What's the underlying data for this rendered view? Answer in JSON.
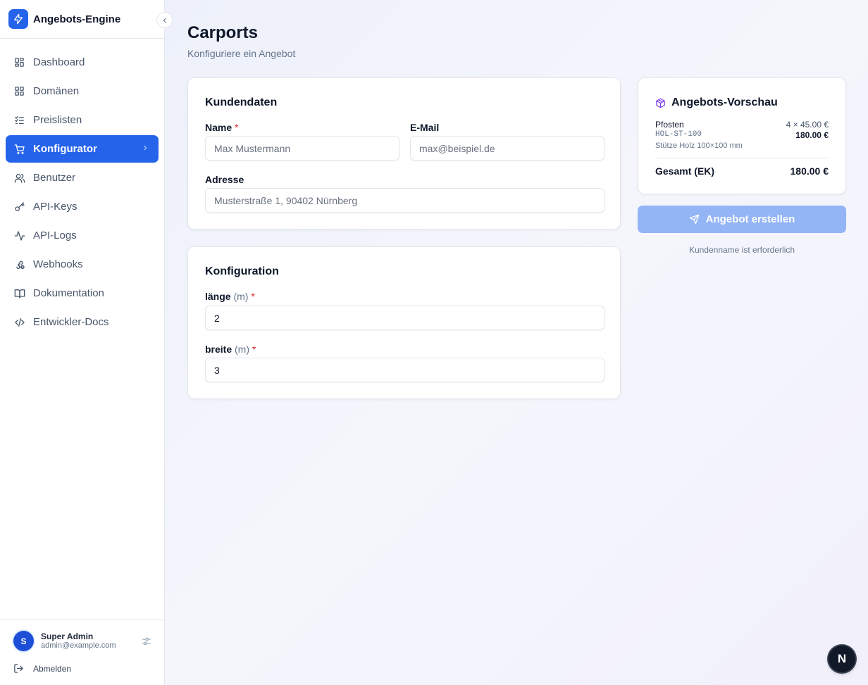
{
  "app": {
    "title": "Angebots-Engine",
    "accent_color": "#2563eb"
  },
  "sidebar": {
    "items": [
      {
        "label": "Dashboard",
        "icon": "layout-grid-icon",
        "active": false
      },
      {
        "label": "Domänen",
        "icon": "grid-icon",
        "active": false
      },
      {
        "label": "Preislisten",
        "icon": "list-checks-icon",
        "active": false
      },
      {
        "label": "Konfigurator",
        "icon": "shopping-cart-icon",
        "active": true
      },
      {
        "label": "Benutzer",
        "icon": "users-icon",
        "active": false
      },
      {
        "label": "API-Keys",
        "icon": "key-icon",
        "active": false
      },
      {
        "label": "API-Logs",
        "icon": "activity-icon",
        "active": false
      },
      {
        "label": "Webhooks",
        "icon": "webhook-icon",
        "active": false
      },
      {
        "label": "Dokumentation",
        "icon": "book-icon",
        "active": false
      },
      {
        "label": "Entwickler-Docs",
        "icon": "code-icon",
        "active": false
      }
    ],
    "user": {
      "initial": "S",
      "name": "Super Admin",
      "email": "admin@example.com"
    },
    "logout_label": "Abmelden"
  },
  "page": {
    "title": "Carports",
    "subtitle": "Konfiguriere ein Angebot"
  },
  "customer": {
    "title": "Kundendaten",
    "name_label": "Name",
    "name_placeholder": "Max Mustermann",
    "email_label": "E-Mail",
    "email_placeholder": "max@beispiel.de",
    "address_label": "Adresse",
    "address_placeholder": "Musterstraße 1, 90402 Nürnberg",
    "required_marker": "*"
  },
  "configuration": {
    "title": "Konfiguration",
    "fields": [
      {
        "label": "länge",
        "unit": "(m)",
        "value": "2"
      },
      {
        "label": "breite",
        "unit": "(m)",
        "value": "3"
      }
    ]
  },
  "preview": {
    "title": "Angebots-Vorschau",
    "line": {
      "name": "Pfosten",
      "qty_price": "4 × 45.00 €",
      "sku": "HOL-ST-100",
      "total": "180.00 €",
      "description": "Stütze Holz 100×100 mm"
    },
    "sum_label": "Gesamt (EK)",
    "sum_value": "180.00 €"
  },
  "actions": {
    "create_label": "Angebot erstellen",
    "hint": "Kundenname ist erforderlich"
  },
  "badge": {
    "letter": "N"
  }
}
